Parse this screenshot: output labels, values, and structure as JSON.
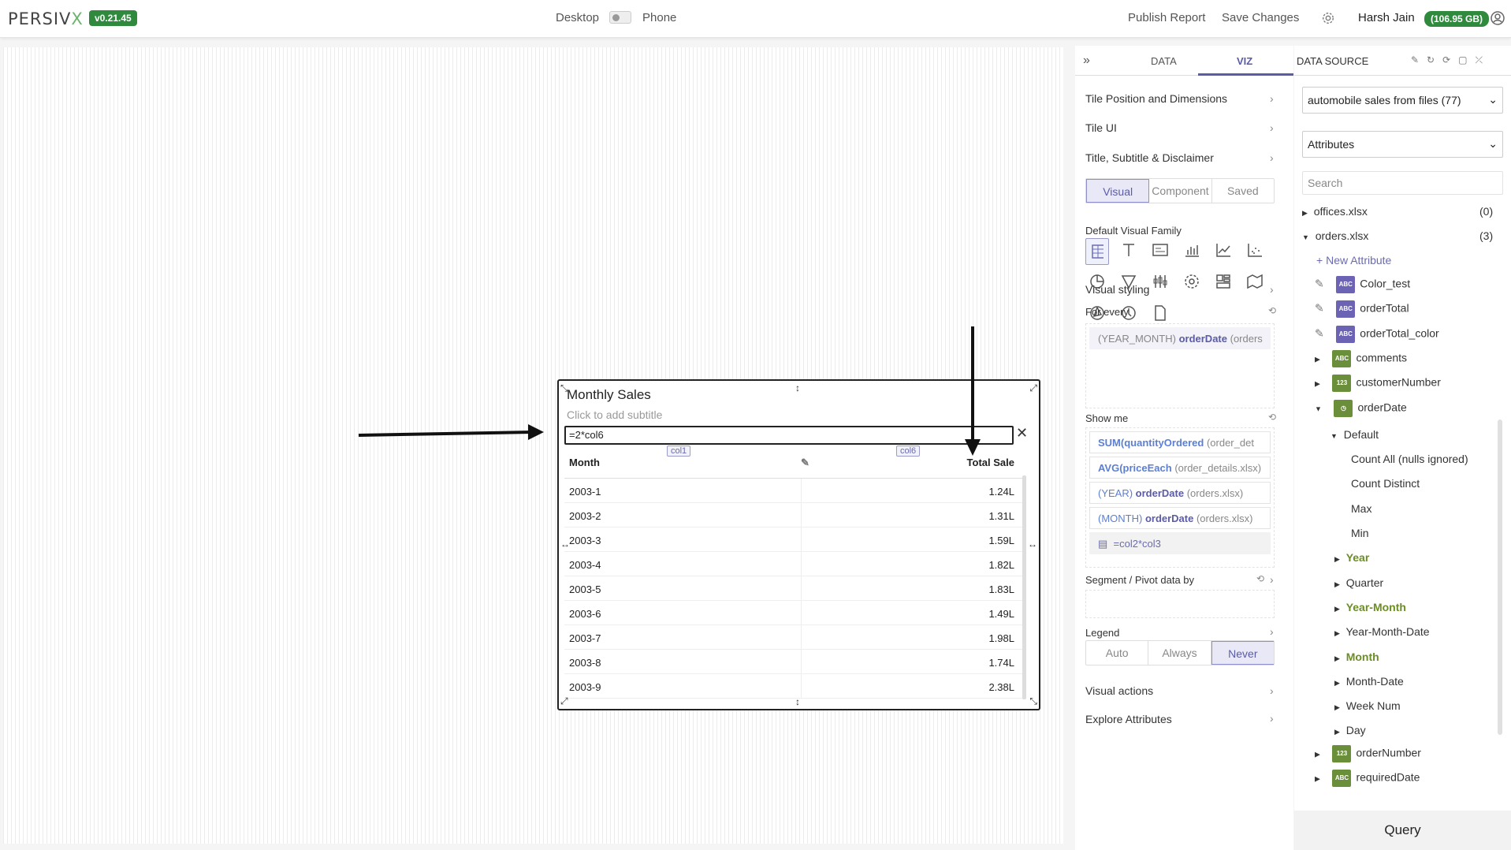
{
  "header": {
    "logo_main": "PERSIV",
    "logo_x": "X",
    "version": "v0.21.45",
    "desktop": "Desktop",
    "phone": "Phone",
    "publish": "Publish Report",
    "save": "Save Changes",
    "user": "Harsh Jain",
    "storage": "(106.95 GB)"
  },
  "tile": {
    "title": "Monthly Sales",
    "subtitle": "Click to add subtitle",
    "formula": "=2*col6",
    "col1_tag": "col1",
    "col6_tag": "col6",
    "h_month": "Month",
    "h_total": "Total Sale",
    "rows": [
      {
        "m": "2003-1",
        "v": "1.24L"
      },
      {
        "m": "2003-2",
        "v": "1.31L"
      },
      {
        "m": "2003-3",
        "v": "1.59L"
      },
      {
        "m": "2003-4",
        "v": "1.82L"
      },
      {
        "m": "2003-5",
        "v": "1.83L"
      },
      {
        "m": "2003-6",
        "v": "1.49L"
      },
      {
        "m": "2003-7",
        "v": "1.98L"
      },
      {
        "m": "2003-8",
        "v": "1.74L"
      },
      {
        "m": "2003-9",
        "v": "2.38L"
      }
    ]
  },
  "viz": {
    "tab_data": "DATA",
    "tab_viz": "VIZ",
    "tile_pos": "Tile Position and Dimensions",
    "tile_ui": "Tile UI",
    "title_sub": "Title, Subtitle & Disclaimer",
    "seg": [
      "Visual",
      "Component",
      "Saved"
    ],
    "family": "Default Visual Family",
    "styling": "Visual styling",
    "for_every": "For every",
    "fe_pre": "(YEAR_MONTH)",
    "fe_bold": "orderDate",
    "fe_post": "(orders",
    "show_me": "Show me",
    "sm": [
      {
        "pre": "SUM(",
        "b": "quantityOrdered",
        "post": " (order_det"
      },
      {
        "pre": "AVG(",
        "b": "priceEach",
        "post": " (order_details.xlsx)"
      },
      {
        "pre": "(YEAR) ",
        "b": "orderDate",
        "post": " (orders.xlsx)"
      },
      {
        "pre": "(MONTH) ",
        "b": "orderDate",
        "post": " (orders.xlsx)"
      }
    ],
    "formula": "=col2*col3",
    "segment": "Segment / Pivot data by",
    "legend": "Legend",
    "legend_opts": [
      "Auto",
      "Always",
      "Never"
    ],
    "actions": "Visual actions",
    "explore": "Explore Attributes"
  },
  "ds": {
    "title": "DATA SOURCE",
    "source": "automobile sales from files (77)",
    "attr": "Attributes",
    "search_ph": "Search",
    "offices": "offices.xlsx",
    "offices_n": "(0)",
    "orders": "orders.xlsx",
    "orders_n": "(3)",
    "new_attr": "New Attribute",
    "fields": [
      {
        "n": "Color_test",
        "b": "ABC"
      },
      {
        "n": "orderTotal",
        "b": "ABC"
      },
      {
        "n": "orderTotal_color",
        "b": "ABC"
      },
      {
        "n": "comments",
        "b": "ABC"
      },
      {
        "n": "customerNumber",
        "b": "123"
      },
      {
        "n": "orderDate",
        "b": "◷"
      }
    ],
    "default": "Default",
    "aggs": [
      "Count All (nulls ignored)",
      "Count Distinct",
      "Max",
      "Min"
    ],
    "dates": [
      "Year",
      "Quarter",
      "Year-Month",
      "Year-Month-Date",
      "Month",
      "Month-Date",
      "Week Num",
      "Day"
    ],
    "more": [
      {
        "n": "orderNumber",
        "b": "123"
      },
      {
        "n": "requiredDate",
        "b": "ABC"
      }
    ],
    "query": "Query"
  }
}
